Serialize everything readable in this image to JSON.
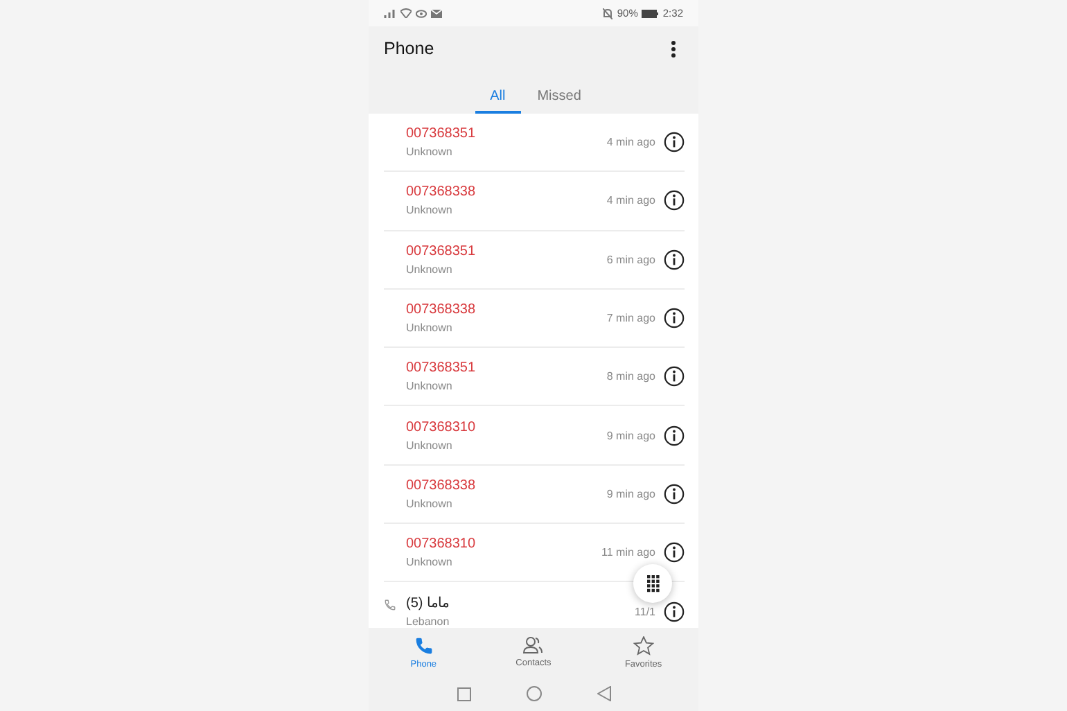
{
  "status_bar": {
    "battery": "90%",
    "time": "2:32"
  },
  "header": {
    "title": "Phone"
  },
  "tabs": [
    {
      "label": "All",
      "selected": true
    },
    {
      "label": "Missed",
      "selected": false
    }
  ],
  "calls": [
    {
      "number": "007368351",
      "label": "Unknown",
      "time": "4 min ago",
      "missed": true
    },
    {
      "number": "007368338",
      "label": "Unknown",
      "time": "4 min ago",
      "missed": true
    },
    {
      "number": "007368351",
      "label": "Unknown",
      "time": "6 min ago",
      "missed": true
    },
    {
      "number": "007368338",
      "label": "Unknown",
      "time": "7 min ago",
      "missed": true
    },
    {
      "number": "007368351",
      "label": "Unknown",
      "time": "8 min ago",
      "missed": true
    },
    {
      "number": "007368310",
      "label": "Unknown",
      "time": "9 min ago",
      "missed": true
    },
    {
      "number": "007368338",
      "label": "Unknown",
      "time": "9 min ago",
      "missed": true
    },
    {
      "number": "007368310",
      "label": "Unknown",
      "time": "11 min ago",
      "missed": true
    },
    {
      "number": "ماما (5)",
      "label": "Lebanon",
      "time": "11/1",
      "missed": false
    }
  ],
  "bottom_nav": [
    {
      "label": "Phone",
      "selected": true,
      "kind": "phone"
    },
    {
      "label": "Contacts",
      "selected": false,
      "kind": "contacts"
    },
    {
      "label": "Favorites",
      "selected": false,
      "kind": "star"
    }
  ]
}
